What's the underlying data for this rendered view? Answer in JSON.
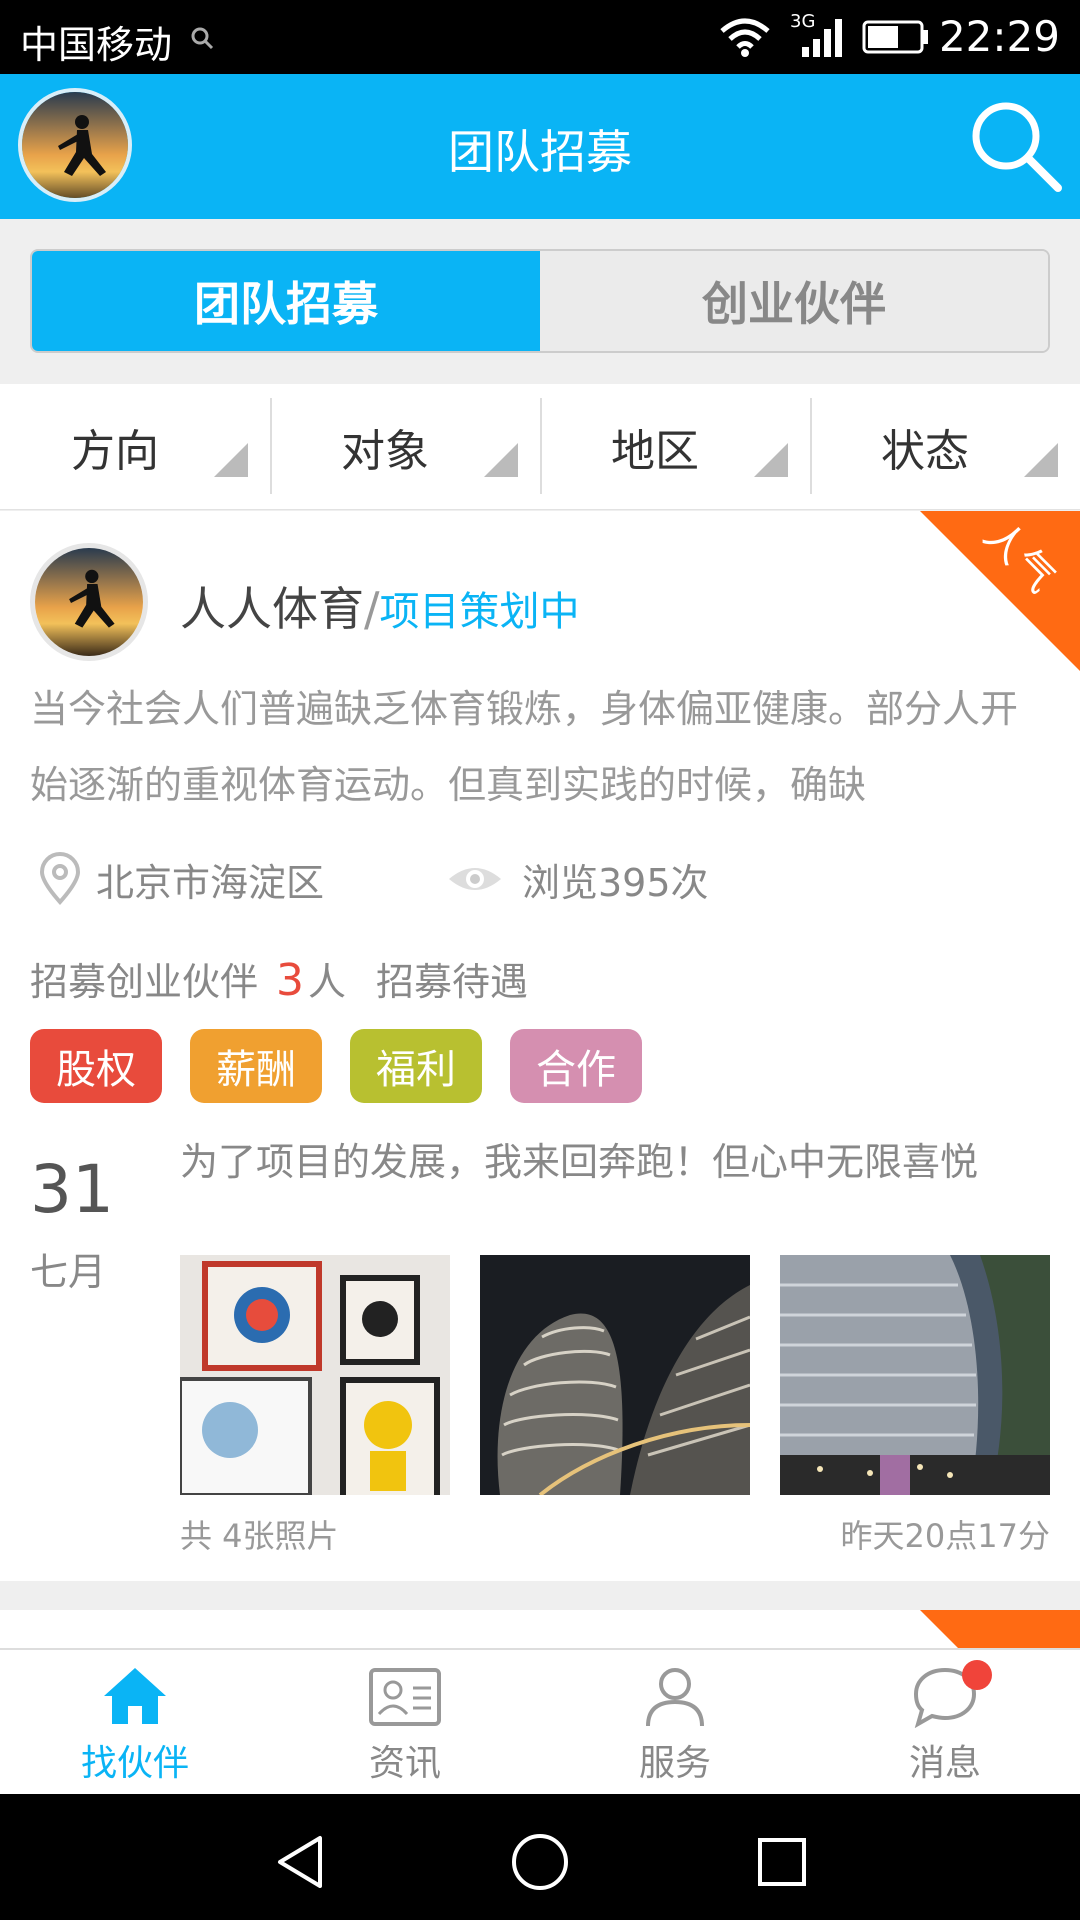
{
  "status_bar": {
    "carrier": "中国移动",
    "network": "3G",
    "time": "22:29"
  },
  "header": {
    "title": "团队招募"
  },
  "segments": [
    {
      "label": "团队招募",
      "active": true
    },
    {
      "label": "创业伙伴",
      "active": false
    }
  ],
  "filters": [
    {
      "label": "方向"
    },
    {
      "label": "对象"
    },
    {
      "label": "地区"
    },
    {
      "label": "状态"
    }
  ],
  "card": {
    "ribbon": "人气",
    "name": "人人体育",
    "separator": "/",
    "stage": "项目策划中",
    "description": "当今社会人们普遍缺乏体育锻炼，身体偏亚健康。部分人开始逐渐的重视体育运动。但真到实践的时候，确缺",
    "location": "北京市海淀区",
    "views": "浏览395次",
    "recruit_label": "招募创业伙伴",
    "recruit_count": "3",
    "recruit_unit": "人",
    "benefits_label": "招募待遇",
    "tags": [
      {
        "label": "股权",
        "color": "#e84b3c"
      },
      {
        "label": "薪酬",
        "color": "#f0a030"
      },
      {
        "label": "福利",
        "color": "#b8c030"
      },
      {
        "label": "合作",
        "color": "#d58fb0"
      }
    ],
    "date_day": "31",
    "date_month": "七月",
    "post_text": "为了项目的发展，我来回奔跑！但心中无限喜悦",
    "photo_count": "共  4张照片",
    "post_time": "昨天20点17分"
  },
  "bottom_nav": [
    {
      "label": "找伙伴",
      "icon": "home-icon",
      "active": true
    },
    {
      "label": "资讯",
      "icon": "news-card-icon",
      "active": false
    },
    {
      "label": "服务",
      "icon": "person-icon",
      "active": false
    },
    {
      "label": "消息",
      "icon": "chat-bubble-icon",
      "active": false,
      "badge": true
    }
  ],
  "colors": {
    "accent": "#0ab4f5",
    "ribbon": "#ff6a13",
    "count": "#e84b3c"
  }
}
